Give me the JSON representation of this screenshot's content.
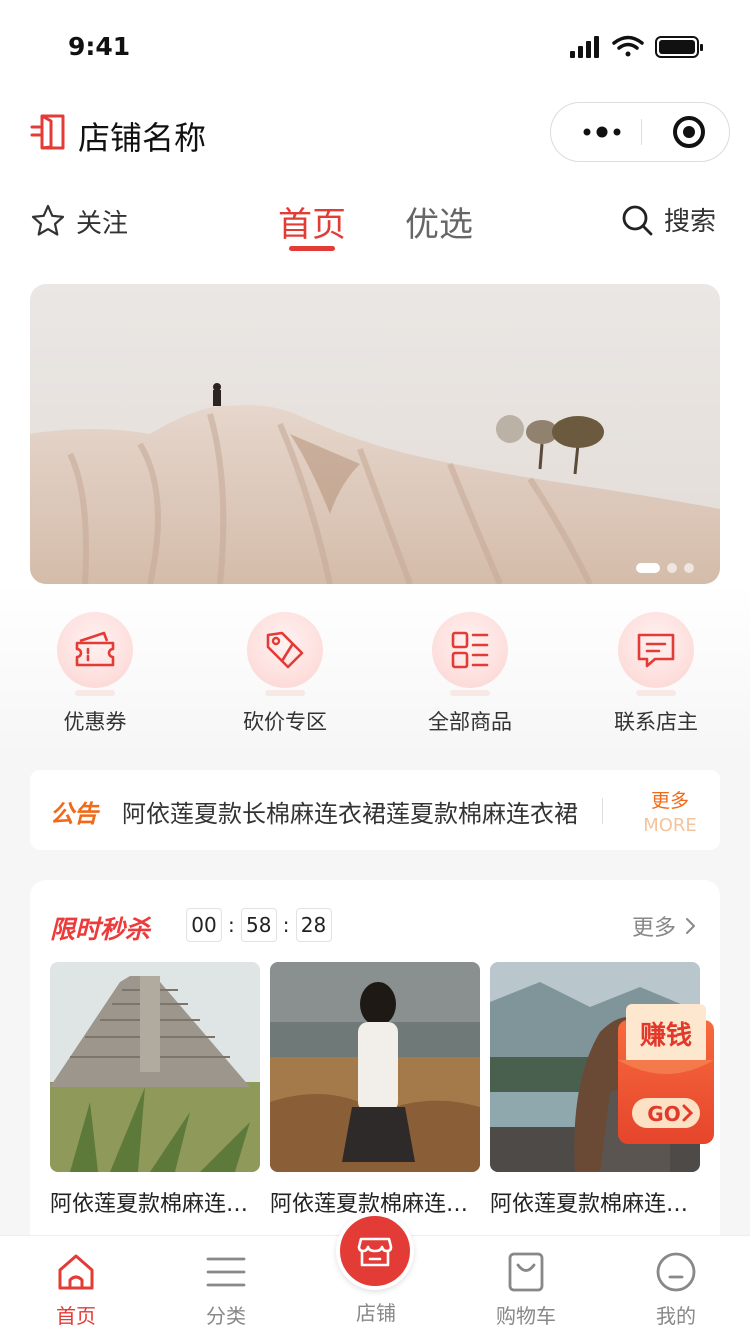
{
  "status_bar": {
    "time": "9:41"
  },
  "header": {
    "store_name": "店铺名称"
  },
  "nav": {
    "follow_label": "关注",
    "tabs": [
      {
        "label": "首页",
        "active": true
      },
      {
        "label": "优选",
        "active": false
      }
    ],
    "search_label": "搜索"
  },
  "banner": {
    "slide_count": 3,
    "active_slide": 1
  },
  "quick_menu": [
    {
      "label": "优惠券",
      "icon": "coupon-icon"
    },
    {
      "label": "砍价专区",
      "icon": "price-tag-icon"
    },
    {
      "label": "全部商品",
      "icon": "grid-list-icon"
    },
    {
      "label": "联系店主",
      "icon": "chat-icon"
    }
  ],
  "notice": {
    "tag": "公告",
    "text": "阿依莲夏款长棉麻连衣裙莲夏款棉麻连衣裙",
    "more_cn": "更多",
    "more_en": "MORE"
  },
  "flash_sale": {
    "title": "限时秒杀",
    "countdown": {
      "hours": "00",
      "minutes": "58",
      "seconds": "28"
    },
    "more_label": "更多",
    "products": [
      {
        "name": "阿依莲夏款棉麻连衣裙"
      },
      {
        "name": "阿依莲夏款棉麻连衣裙"
      },
      {
        "name": "阿依莲夏款棉麻连衣裙"
      }
    ]
  },
  "earn_badge": {
    "label": "赚钱",
    "button": "GO"
  },
  "tab_bar": {
    "items": [
      {
        "label": "首页",
        "icon": "home-icon",
        "active": true
      },
      {
        "label": "分类",
        "icon": "menu-icon",
        "active": false
      },
      {
        "label": "店铺",
        "icon": "store-icon",
        "active": false
      },
      {
        "label": "购物车",
        "icon": "bag-icon",
        "active": false
      },
      {
        "label": "我的",
        "icon": "profile-icon",
        "active": false
      }
    ]
  },
  "colors": {
    "accent": "#e33b36",
    "notice": "#f06a19",
    "background": "#f6f6f6"
  }
}
